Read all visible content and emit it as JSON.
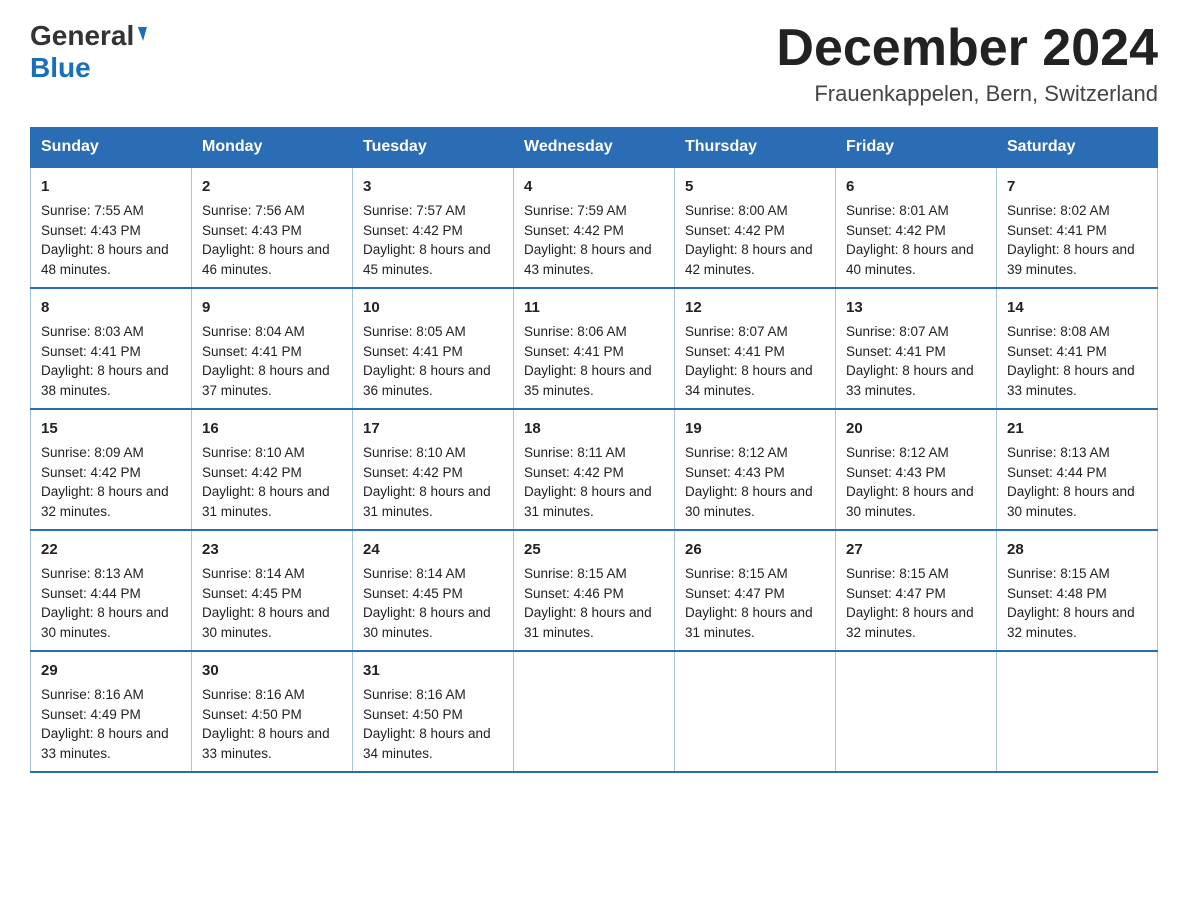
{
  "header": {
    "month_title": "December 2024",
    "location": "Frauenkappelen, Bern, Switzerland",
    "logo_general": "General",
    "logo_blue": "Blue"
  },
  "days_of_week": [
    "Sunday",
    "Monday",
    "Tuesday",
    "Wednesday",
    "Thursday",
    "Friday",
    "Saturday"
  ],
  "weeks": [
    [
      {
        "day": 1,
        "sunrise": "7:55 AM",
        "sunset": "4:43 PM",
        "daylight": "8 hours and 48 minutes."
      },
      {
        "day": 2,
        "sunrise": "7:56 AM",
        "sunset": "4:43 PM",
        "daylight": "8 hours and 46 minutes."
      },
      {
        "day": 3,
        "sunrise": "7:57 AM",
        "sunset": "4:42 PM",
        "daylight": "8 hours and 45 minutes."
      },
      {
        "day": 4,
        "sunrise": "7:59 AM",
        "sunset": "4:42 PM",
        "daylight": "8 hours and 43 minutes."
      },
      {
        "day": 5,
        "sunrise": "8:00 AM",
        "sunset": "4:42 PM",
        "daylight": "8 hours and 42 minutes."
      },
      {
        "day": 6,
        "sunrise": "8:01 AM",
        "sunset": "4:42 PM",
        "daylight": "8 hours and 40 minutes."
      },
      {
        "day": 7,
        "sunrise": "8:02 AM",
        "sunset": "4:41 PM",
        "daylight": "8 hours and 39 minutes."
      }
    ],
    [
      {
        "day": 8,
        "sunrise": "8:03 AM",
        "sunset": "4:41 PM",
        "daylight": "8 hours and 38 minutes."
      },
      {
        "day": 9,
        "sunrise": "8:04 AM",
        "sunset": "4:41 PM",
        "daylight": "8 hours and 37 minutes."
      },
      {
        "day": 10,
        "sunrise": "8:05 AM",
        "sunset": "4:41 PM",
        "daylight": "8 hours and 36 minutes."
      },
      {
        "day": 11,
        "sunrise": "8:06 AM",
        "sunset": "4:41 PM",
        "daylight": "8 hours and 35 minutes."
      },
      {
        "day": 12,
        "sunrise": "8:07 AM",
        "sunset": "4:41 PM",
        "daylight": "8 hours and 34 minutes."
      },
      {
        "day": 13,
        "sunrise": "8:07 AM",
        "sunset": "4:41 PM",
        "daylight": "8 hours and 33 minutes."
      },
      {
        "day": 14,
        "sunrise": "8:08 AM",
        "sunset": "4:41 PM",
        "daylight": "8 hours and 33 minutes."
      }
    ],
    [
      {
        "day": 15,
        "sunrise": "8:09 AM",
        "sunset": "4:42 PM",
        "daylight": "8 hours and 32 minutes."
      },
      {
        "day": 16,
        "sunrise": "8:10 AM",
        "sunset": "4:42 PM",
        "daylight": "8 hours and 31 minutes."
      },
      {
        "day": 17,
        "sunrise": "8:10 AM",
        "sunset": "4:42 PM",
        "daylight": "8 hours and 31 minutes."
      },
      {
        "day": 18,
        "sunrise": "8:11 AM",
        "sunset": "4:42 PM",
        "daylight": "8 hours and 31 minutes."
      },
      {
        "day": 19,
        "sunrise": "8:12 AM",
        "sunset": "4:43 PM",
        "daylight": "8 hours and 30 minutes."
      },
      {
        "day": 20,
        "sunrise": "8:12 AM",
        "sunset": "4:43 PM",
        "daylight": "8 hours and 30 minutes."
      },
      {
        "day": 21,
        "sunrise": "8:13 AM",
        "sunset": "4:44 PM",
        "daylight": "8 hours and 30 minutes."
      }
    ],
    [
      {
        "day": 22,
        "sunrise": "8:13 AM",
        "sunset": "4:44 PM",
        "daylight": "8 hours and 30 minutes."
      },
      {
        "day": 23,
        "sunrise": "8:14 AM",
        "sunset": "4:45 PM",
        "daylight": "8 hours and 30 minutes."
      },
      {
        "day": 24,
        "sunrise": "8:14 AM",
        "sunset": "4:45 PM",
        "daylight": "8 hours and 30 minutes."
      },
      {
        "day": 25,
        "sunrise": "8:15 AM",
        "sunset": "4:46 PM",
        "daylight": "8 hours and 31 minutes."
      },
      {
        "day": 26,
        "sunrise": "8:15 AM",
        "sunset": "4:47 PM",
        "daylight": "8 hours and 31 minutes."
      },
      {
        "day": 27,
        "sunrise": "8:15 AM",
        "sunset": "4:47 PM",
        "daylight": "8 hours and 32 minutes."
      },
      {
        "day": 28,
        "sunrise": "8:15 AM",
        "sunset": "4:48 PM",
        "daylight": "8 hours and 32 minutes."
      }
    ],
    [
      {
        "day": 29,
        "sunrise": "8:16 AM",
        "sunset": "4:49 PM",
        "daylight": "8 hours and 33 minutes."
      },
      {
        "day": 30,
        "sunrise": "8:16 AM",
        "sunset": "4:50 PM",
        "daylight": "8 hours and 33 minutes."
      },
      {
        "day": 31,
        "sunrise": "8:16 AM",
        "sunset": "4:50 PM",
        "daylight": "8 hours and 34 minutes."
      },
      null,
      null,
      null,
      null
    ]
  ],
  "labels": {
    "sunrise": "Sunrise:",
    "sunset": "Sunset:",
    "daylight": "Daylight:"
  }
}
